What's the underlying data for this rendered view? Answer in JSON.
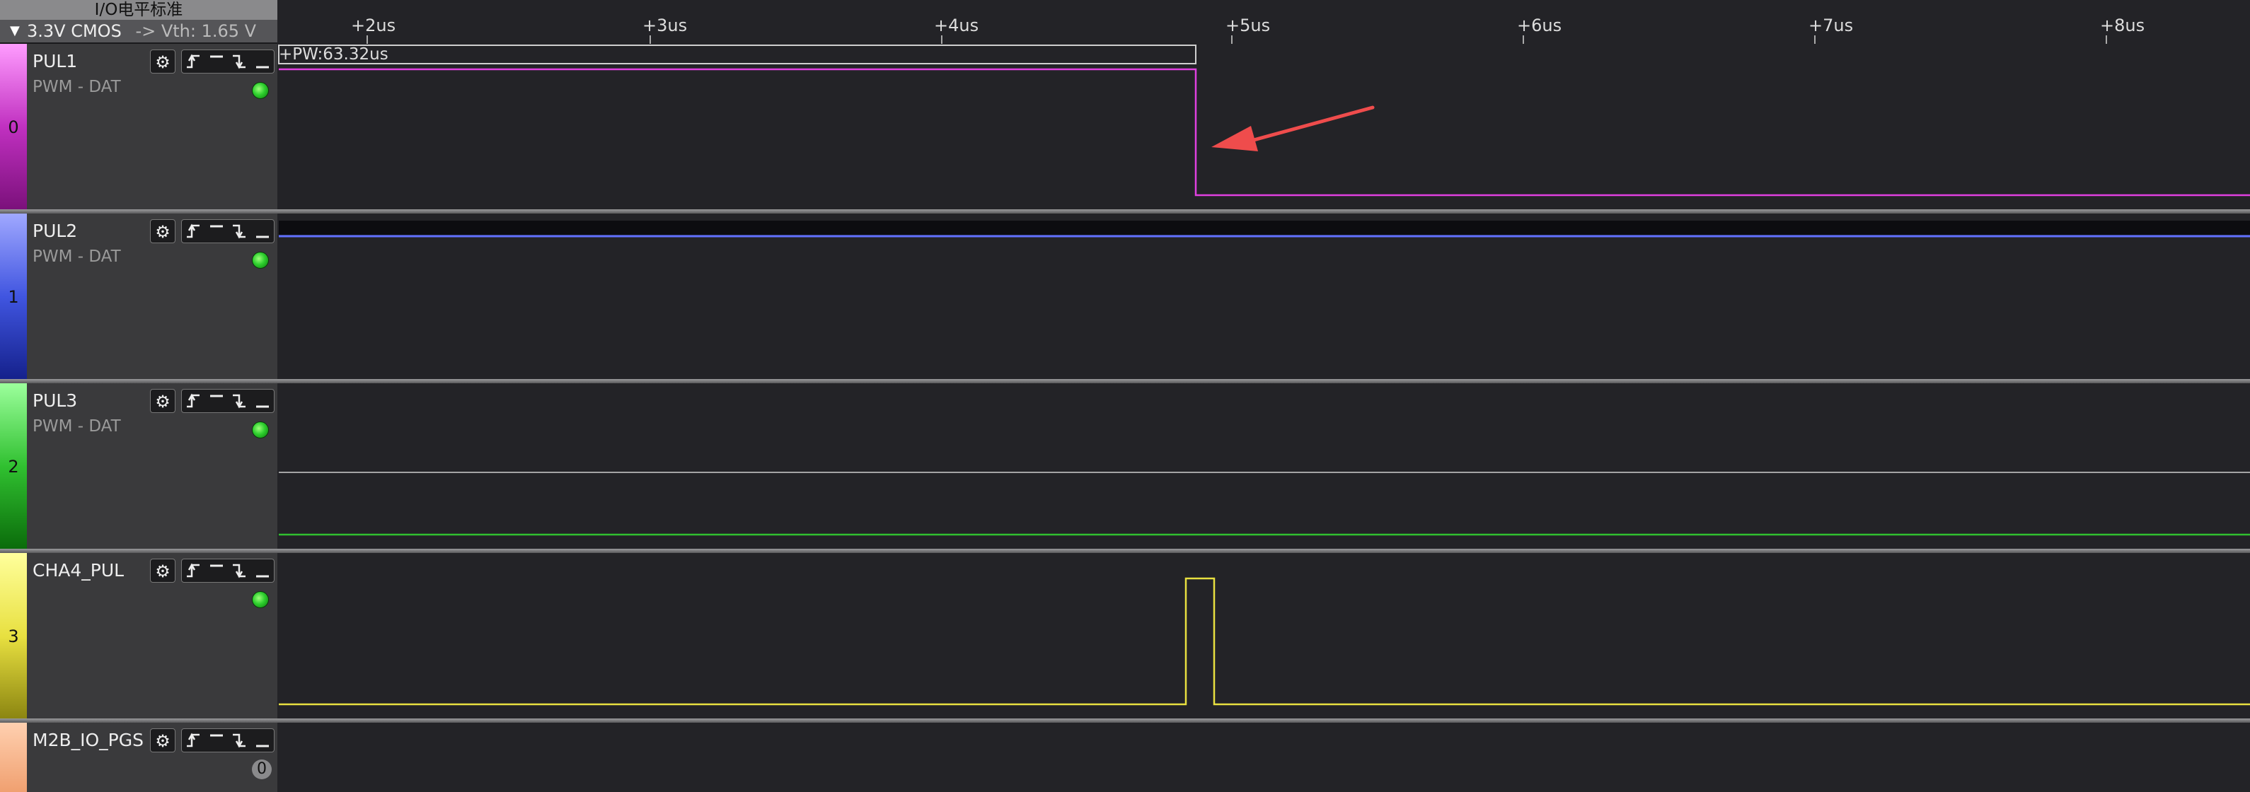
{
  "header": {
    "title": "I/O电平标准",
    "standard": "3.3V CMOS",
    "threshold": "-> Vth: 1.65 V"
  },
  "timeline": {
    "ticks": [
      "+2us",
      "+3us",
      "+4us",
      "+5us",
      "+6us",
      "+7us",
      "+8us"
    ]
  },
  "measurement": {
    "pulse_width": "+PW:63.32us"
  },
  "channels": [
    {
      "index": "0",
      "name": "PUL1",
      "decoder": "PWM - DAT",
      "color": "#e040e0"
    },
    {
      "index": "1",
      "name": "PUL2",
      "decoder": "PWM - DAT",
      "color": "#4055e0"
    },
    {
      "index": "2",
      "name": "PUL3",
      "decoder": "PWM - DAT",
      "color": "#30c030"
    },
    {
      "index": "3",
      "name": "CHA4_PUL",
      "decoder": "",
      "color": "#e8e040"
    },
    {
      "index": "",
      "name": "M2B_IO_PGS",
      "decoder": "",
      "color": "#f0a070",
      "count": "0"
    }
  ],
  "colors": {
    "annotation_arrow": "#ef4c4c",
    "background": "#232327",
    "panel": "#3a3a3c"
  },
  "icons": {
    "settings": "gear-icon",
    "triggers": [
      "rising-edge-icon",
      "high-level-icon",
      "falling-edge-icon",
      "low-level-icon"
    ]
  }
}
